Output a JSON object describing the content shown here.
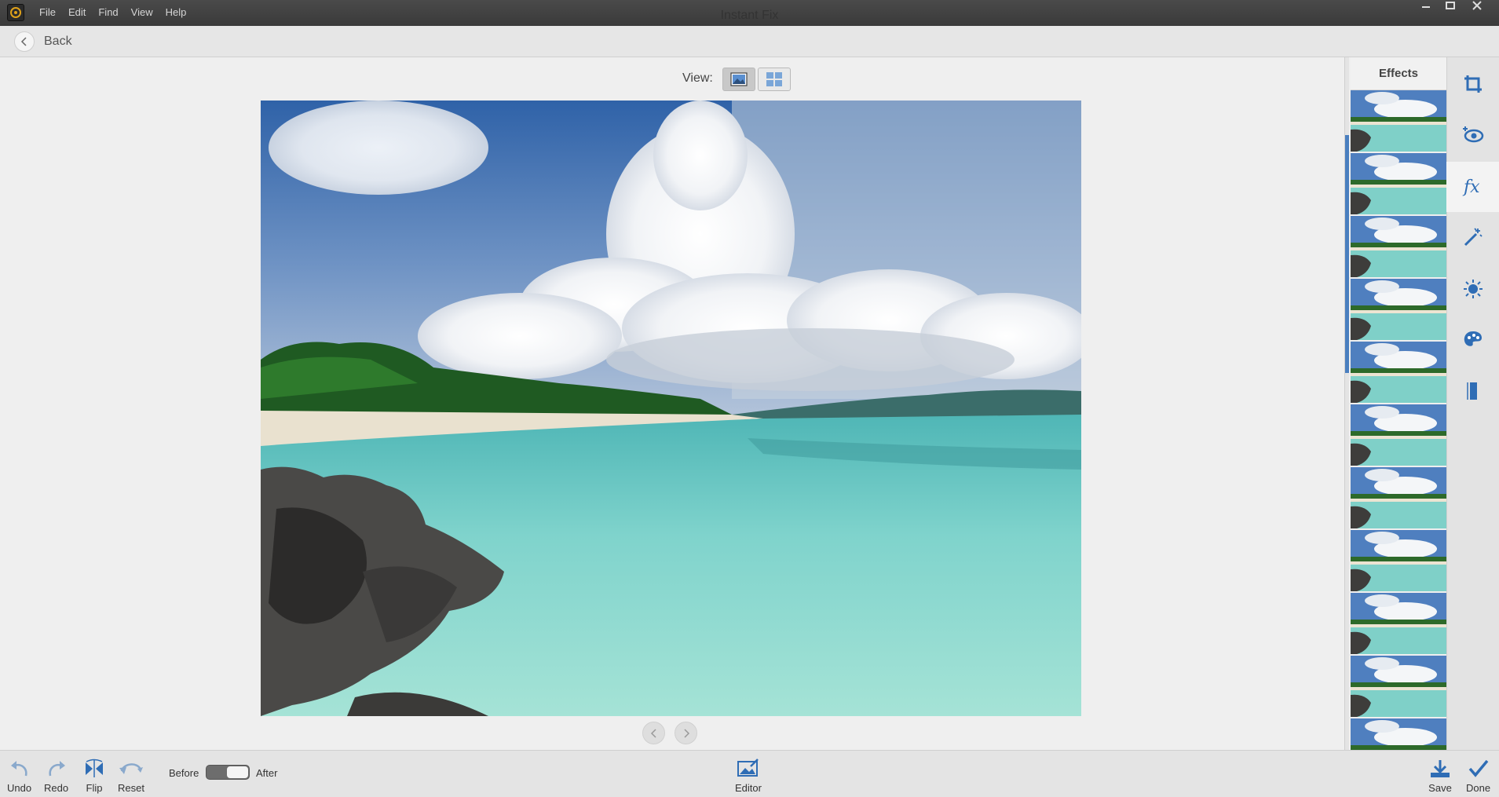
{
  "menu": {
    "items": [
      "File",
      "Edit",
      "Find",
      "View",
      "Help"
    ]
  },
  "header": {
    "back_label": "Back",
    "title": "Instant Fix"
  },
  "view": {
    "label": "View:"
  },
  "panel": {
    "title": "Effects",
    "thumbnail_count": 11
  },
  "tools": [
    "crop-icon",
    "red-eye-icon",
    "fx-icon",
    "magic-wand-icon",
    "brightness-icon",
    "color-palette-icon",
    "straighten-icon"
  ],
  "bottom": {
    "undo": "Undo",
    "redo": "Redo",
    "flip": "Flip",
    "reset": "Reset",
    "before": "Before",
    "after": "After",
    "editor": "Editor",
    "save": "Save",
    "done": "Done"
  },
  "colors": {
    "accent": "#4a7fbf",
    "icon_blue": "#2f6db5"
  }
}
